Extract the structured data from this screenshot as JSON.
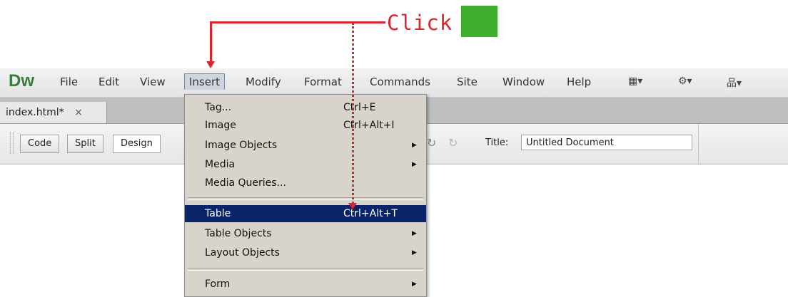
{
  "annotation": {
    "click_label": "Click"
  },
  "menubar": {
    "logo": "Dw",
    "items": [
      "File",
      "Edit",
      "View",
      "Insert",
      "Modify",
      "Format",
      "Commands",
      "Site",
      "Window",
      "Help"
    ],
    "tools": [
      "layout-icon ▾",
      "gear-icon ▾",
      "sitemap-icon ▾"
    ]
  },
  "tabs": {
    "doc": "index.html*",
    "close": "×"
  },
  "viewbar": {
    "code": "Code",
    "split": "Split",
    "design": "Design",
    "title_label": "Title:",
    "title_value": "Untitled Document"
  },
  "insert_menu": {
    "items": [
      {
        "label": "Tag...",
        "shortcut": "Ctrl+E"
      },
      {
        "label": "Image",
        "shortcut": "Ctrl+Alt+I"
      },
      {
        "label": "Image Objects",
        "submenu": true
      },
      {
        "label": "Media",
        "submenu": true
      },
      {
        "label": "Media Queries..."
      },
      {
        "label": "Table",
        "shortcut": "Ctrl+Alt+T",
        "highlighted": true
      },
      {
        "label": "Table Objects",
        "submenu": true
      },
      {
        "label": "Layout Objects",
        "submenu": true
      },
      {
        "label": "Form",
        "submenu": true
      }
    ]
  }
}
